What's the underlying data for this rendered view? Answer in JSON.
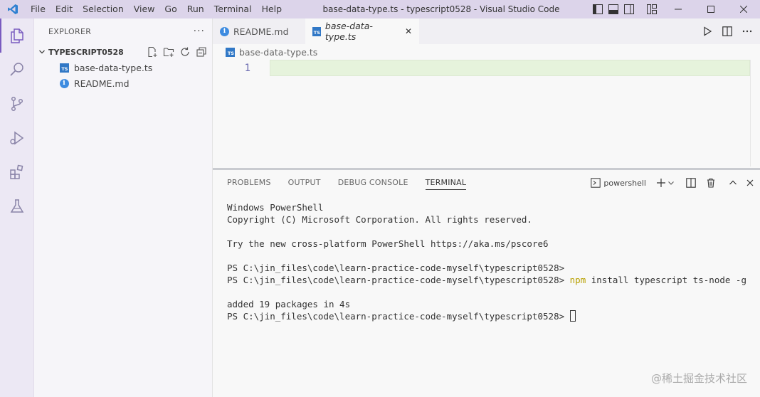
{
  "titlebar": {
    "menu": [
      "File",
      "Edit",
      "Selection",
      "View",
      "Go",
      "Run",
      "Terminal",
      "Help"
    ],
    "title": "base-data-type.ts - typescript0528 - Visual Studio Code"
  },
  "activitybar": {
    "items": [
      "explorer-icon",
      "search-icon",
      "source-control-icon",
      "run-debug-icon",
      "extensions-icon",
      "testing-icon"
    ]
  },
  "sidebar": {
    "title": "EXPLORER",
    "more": "···",
    "folder": "TYPESCRIPT0528",
    "files": [
      {
        "name": "base-data-type.ts",
        "icon": "ts-file-icon",
        "badge": "TS"
      },
      {
        "name": "README.md",
        "icon": "info-file-icon",
        "badge": "i"
      }
    ]
  },
  "editor": {
    "tabs": [
      {
        "label": "README.md",
        "active": false,
        "badge": "i"
      },
      {
        "label": "base-data-type.ts",
        "active": true,
        "badge": "TS",
        "close": "✕"
      }
    ],
    "breadcrumb": "base-data-type.ts",
    "breadcrumb_badge": "TS",
    "line_number": "1"
  },
  "panel": {
    "tabs": [
      "PROBLEMS",
      "OUTPUT",
      "DEBUG CONSOLE",
      "TERMINAL"
    ],
    "active_tab": "TERMINAL",
    "shell": "powershell",
    "terminal": {
      "line1": "Windows PowerShell",
      "line2": "Copyright (C) Microsoft Corporation. All rights reserved.",
      "line3": "Try the new cross-platform PowerShell https://aka.ms/pscore6",
      "line4": "PS C:\\jin_files\\code\\learn-practice-code-myself\\typescript0528>",
      "line5_prompt": "PS C:\\jin_files\\code\\learn-practice-code-myself\\typescript0528> ",
      "line5_cmd": "npm",
      "line5_args": " install typescript ts-node -g",
      "line6": "added 19 packages in 4s",
      "line7": "PS C:\\jin_files\\code\\learn-practice-code-myself\\typescript0528> "
    }
  },
  "watermark": "@稀土掘金技术社区",
  "colors": {
    "titlebar": "#dcd4ea",
    "activitybar": "#ece8f4",
    "accent": "#7a5cc0",
    "ts_blue": "#3178c6",
    "line_highlight": "#e6f3dc",
    "npm_yellow": "#b8a000"
  }
}
